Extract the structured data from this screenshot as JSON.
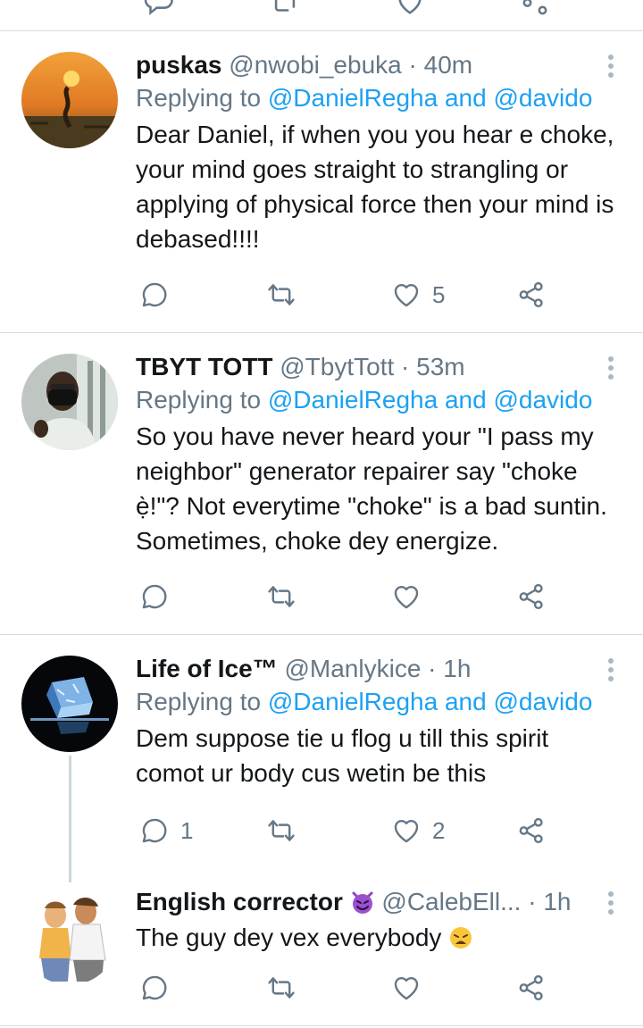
{
  "tweets": [
    {
      "name": "puskas",
      "handle": "@nwobi_ebuka",
      "dot": "·",
      "time": "40m",
      "replying_prefix": "Replying to",
      "mention1": "@DanielRegha",
      "and": "and",
      "mention2": "@davido",
      "text": "Dear Daniel, if when you you hear e choke, your mind goes straight to strangling or applying of physical force then your mind is debased!!!!",
      "reply_count": "",
      "like_count": "5"
    },
    {
      "name": "TBYT TOTT",
      "handle": "@TbytTott",
      "dot": "·",
      "time": "53m",
      "replying_prefix": "Replying to",
      "mention1": "@DanielRegha",
      "and": "and",
      "mention2": "@davido",
      "text": "So you have never heard your \"I pass my neighbor\" generator repairer say \"choke ẹ̀!\"? Not everytime \"choke\" is a bad suntin. Sometimes, choke dey energize.",
      "reply_count": "",
      "like_count": ""
    },
    {
      "name": "Life of Ice™",
      "handle": "@Manlykice",
      "dot": "·",
      "time": "1h",
      "replying_prefix": "Replying to",
      "mention1": "@DanielRegha",
      "and": "and",
      "mention2": "@davido",
      "text": "Dem suppose tie u flog u till this spirit comot ur body cus wetin be this",
      "reply_count": "1",
      "like_count": "2"
    },
    {
      "name": "English corrector",
      "handle": "@CalebEll...",
      "dot": "·",
      "time": "1h",
      "text": "The guy dey vex everybody",
      "reply_count": "",
      "like_count": ""
    }
  ],
  "colors": {
    "accent": "#1da1f2",
    "secondary_text": "#657786",
    "divider": "#d6dbdf"
  },
  "icons": [
    "reply-icon",
    "retweet-icon",
    "like-icon",
    "share-icon",
    "more-icon",
    "smiling-devil-emoji",
    "weary-face-emoji"
  ]
}
